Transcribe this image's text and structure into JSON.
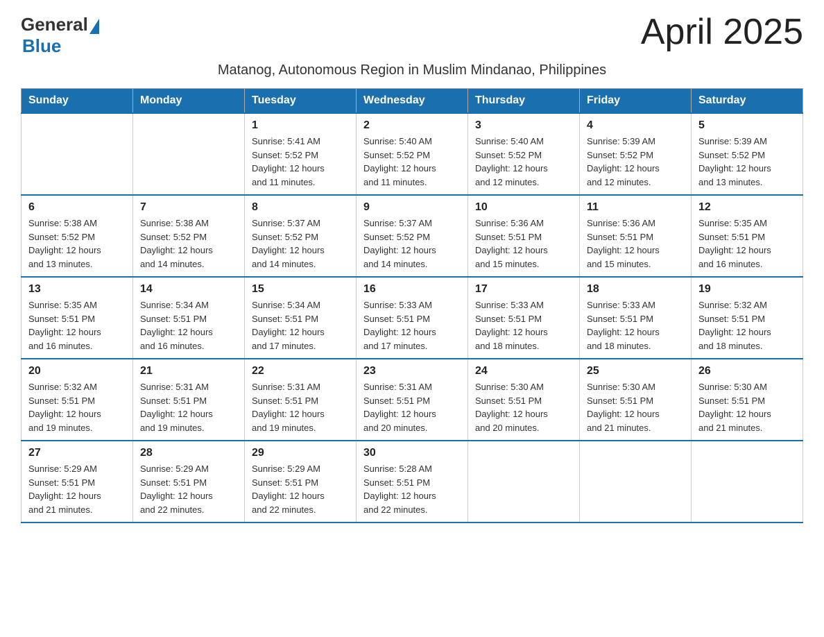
{
  "header": {
    "logo_general": "General",
    "logo_blue": "Blue",
    "month_title": "April 2025",
    "subtitle": "Matanog, Autonomous Region in Muslim Mindanao, Philippines"
  },
  "days_of_week": [
    "Sunday",
    "Monday",
    "Tuesday",
    "Wednesday",
    "Thursday",
    "Friday",
    "Saturday"
  ],
  "weeks": [
    [
      {
        "day": "",
        "detail": ""
      },
      {
        "day": "",
        "detail": ""
      },
      {
        "day": "1",
        "detail": "Sunrise: 5:41 AM\nSunset: 5:52 PM\nDaylight: 12 hours\nand 11 minutes."
      },
      {
        "day": "2",
        "detail": "Sunrise: 5:40 AM\nSunset: 5:52 PM\nDaylight: 12 hours\nand 11 minutes."
      },
      {
        "day": "3",
        "detail": "Sunrise: 5:40 AM\nSunset: 5:52 PM\nDaylight: 12 hours\nand 12 minutes."
      },
      {
        "day": "4",
        "detail": "Sunrise: 5:39 AM\nSunset: 5:52 PM\nDaylight: 12 hours\nand 12 minutes."
      },
      {
        "day": "5",
        "detail": "Sunrise: 5:39 AM\nSunset: 5:52 PM\nDaylight: 12 hours\nand 13 minutes."
      }
    ],
    [
      {
        "day": "6",
        "detail": "Sunrise: 5:38 AM\nSunset: 5:52 PM\nDaylight: 12 hours\nand 13 minutes."
      },
      {
        "day": "7",
        "detail": "Sunrise: 5:38 AM\nSunset: 5:52 PM\nDaylight: 12 hours\nand 14 minutes."
      },
      {
        "day": "8",
        "detail": "Sunrise: 5:37 AM\nSunset: 5:52 PM\nDaylight: 12 hours\nand 14 minutes."
      },
      {
        "day": "9",
        "detail": "Sunrise: 5:37 AM\nSunset: 5:52 PM\nDaylight: 12 hours\nand 14 minutes."
      },
      {
        "day": "10",
        "detail": "Sunrise: 5:36 AM\nSunset: 5:51 PM\nDaylight: 12 hours\nand 15 minutes."
      },
      {
        "day": "11",
        "detail": "Sunrise: 5:36 AM\nSunset: 5:51 PM\nDaylight: 12 hours\nand 15 minutes."
      },
      {
        "day": "12",
        "detail": "Sunrise: 5:35 AM\nSunset: 5:51 PM\nDaylight: 12 hours\nand 16 minutes."
      }
    ],
    [
      {
        "day": "13",
        "detail": "Sunrise: 5:35 AM\nSunset: 5:51 PM\nDaylight: 12 hours\nand 16 minutes."
      },
      {
        "day": "14",
        "detail": "Sunrise: 5:34 AM\nSunset: 5:51 PM\nDaylight: 12 hours\nand 16 minutes."
      },
      {
        "day": "15",
        "detail": "Sunrise: 5:34 AM\nSunset: 5:51 PM\nDaylight: 12 hours\nand 17 minutes."
      },
      {
        "day": "16",
        "detail": "Sunrise: 5:33 AM\nSunset: 5:51 PM\nDaylight: 12 hours\nand 17 minutes."
      },
      {
        "day": "17",
        "detail": "Sunrise: 5:33 AM\nSunset: 5:51 PM\nDaylight: 12 hours\nand 18 minutes."
      },
      {
        "day": "18",
        "detail": "Sunrise: 5:33 AM\nSunset: 5:51 PM\nDaylight: 12 hours\nand 18 minutes."
      },
      {
        "day": "19",
        "detail": "Sunrise: 5:32 AM\nSunset: 5:51 PM\nDaylight: 12 hours\nand 18 minutes."
      }
    ],
    [
      {
        "day": "20",
        "detail": "Sunrise: 5:32 AM\nSunset: 5:51 PM\nDaylight: 12 hours\nand 19 minutes."
      },
      {
        "day": "21",
        "detail": "Sunrise: 5:31 AM\nSunset: 5:51 PM\nDaylight: 12 hours\nand 19 minutes."
      },
      {
        "day": "22",
        "detail": "Sunrise: 5:31 AM\nSunset: 5:51 PM\nDaylight: 12 hours\nand 19 minutes."
      },
      {
        "day": "23",
        "detail": "Sunrise: 5:31 AM\nSunset: 5:51 PM\nDaylight: 12 hours\nand 20 minutes."
      },
      {
        "day": "24",
        "detail": "Sunrise: 5:30 AM\nSunset: 5:51 PM\nDaylight: 12 hours\nand 20 minutes."
      },
      {
        "day": "25",
        "detail": "Sunrise: 5:30 AM\nSunset: 5:51 PM\nDaylight: 12 hours\nand 21 minutes."
      },
      {
        "day": "26",
        "detail": "Sunrise: 5:30 AM\nSunset: 5:51 PM\nDaylight: 12 hours\nand 21 minutes."
      }
    ],
    [
      {
        "day": "27",
        "detail": "Sunrise: 5:29 AM\nSunset: 5:51 PM\nDaylight: 12 hours\nand 21 minutes."
      },
      {
        "day": "28",
        "detail": "Sunrise: 5:29 AM\nSunset: 5:51 PM\nDaylight: 12 hours\nand 22 minutes."
      },
      {
        "day": "29",
        "detail": "Sunrise: 5:29 AM\nSunset: 5:51 PM\nDaylight: 12 hours\nand 22 minutes."
      },
      {
        "day": "30",
        "detail": "Sunrise: 5:28 AM\nSunset: 5:51 PM\nDaylight: 12 hours\nand 22 minutes."
      },
      {
        "day": "",
        "detail": ""
      },
      {
        "day": "",
        "detail": ""
      },
      {
        "day": "",
        "detail": ""
      }
    ]
  ]
}
